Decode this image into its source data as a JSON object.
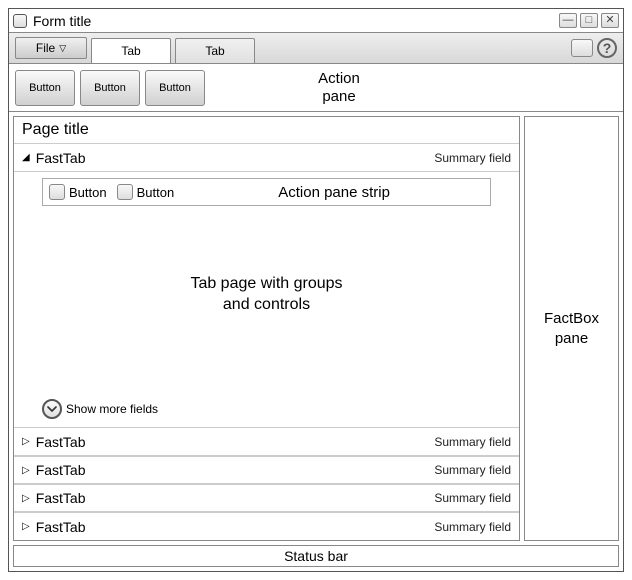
{
  "window": {
    "title": "Form title"
  },
  "menu": {
    "file_label": "File",
    "tabs": [
      "Tab",
      "Tab"
    ]
  },
  "actionPane": {
    "buttons": [
      "Button",
      "Button",
      "Button"
    ],
    "label_line1": "Action",
    "label_line2": "pane"
  },
  "page": {
    "title": "Page title"
  },
  "expandedFastTab": {
    "title": "FastTab",
    "summary": "Summary field",
    "strip": {
      "buttons": [
        "Button",
        "Button"
      ],
      "label": "Action pane strip"
    },
    "tabPage_line1": "Tab page with groups",
    "tabPage_line2": "and controls",
    "showMore": "Show more fields"
  },
  "collapsedFastTabs": [
    {
      "title": "FastTab",
      "summary": "Summary field"
    },
    {
      "title": "FastTab",
      "summary": "Summary field"
    },
    {
      "title": "FastTab",
      "summary": "Summary field"
    },
    {
      "title": "FastTab",
      "summary": "Summary field"
    }
  ],
  "factbox_line1": "FactBox",
  "factbox_line2": "pane",
  "statusbar": "Status bar"
}
